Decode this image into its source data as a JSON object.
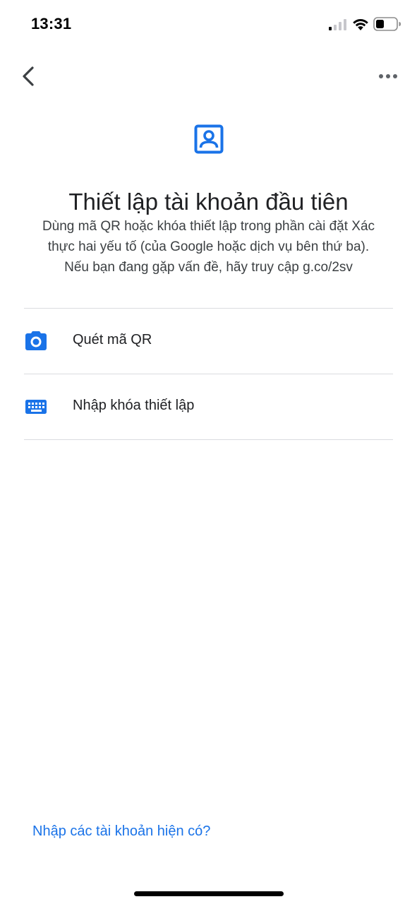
{
  "status_bar": {
    "time": "13:31",
    "icons": [
      "signal-icon",
      "wifi-icon",
      "battery-icon"
    ]
  },
  "top_bar": {
    "back_icon": "chevron-left-icon",
    "more_icon": "more-horizontal-icon"
  },
  "header": {
    "icon": "account-box-icon",
    "title": "Thiết lập tài khoản đầu tiên",
    "description_lines": [
      "Dùng mã QR hoặc khóa thiết lập trong phần cài đặt Xác",
      "thực hai yếu tố (của Google hoặc dịch vụ bên thứ ba).",
      "Nếu bạn đang gặp vấn đề, hãy truy cập g.co/2sv"
    ]
  },
  "options": [
    {
      "icon": "camera-icon",
      "label": "Quét mã QR"
    },
    {
      "icon": "keyboard-icon",
      "label": "Nhập khóa thiết lập"
    }
  ],
  "footer": {
    "import_link": "Nhập các tài khoản hiện có?"
  },
  "colors": {
    "accent": "#1a73e8",
    "text_primary": "#202124",
    "text_secondary": "#3c4043",
    "divider": "#dadce0"
  }
}
